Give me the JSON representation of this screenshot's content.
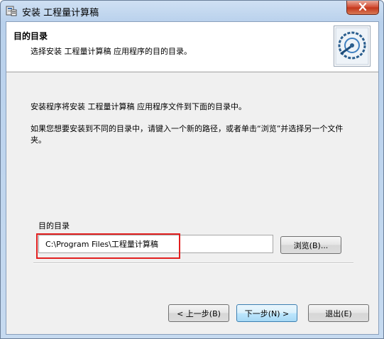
{
  "window": {
    "title": "安装 工程量计算稿"
  },
  "banner": {
    "title": "目的目录",
    "subtitle": "选择安装 工程量计算稿 应用程序的目的目录。"
  },
  "body": {
    "line1": "安装程序将安装 工程量计算稿 应用程序文件到下面的目录中。",
    "line2": "如果您想要安装到不同的目录中，请键入一个新的路径，或者单击“浏览”并选择另一个文件夹。"
  },
  "destination": {
    "label": "目的目录",
    "path": "C:\\Program Files\\工程量计算稿",
    "browse_label": "浏览(B)..."
  },
  "footer": {
    "back_label": "< 上一步(B)",
    "next_label": "下一步(N) >",
    "exit_label": "退出(E)"
  },
  "colors": {
    "highlight": "#e21f1f",
    "close_button": "#c2351b"
  },
  "icons": {
    "app": "installer-app-icon",
    "close": "close-icon",
    "banner": "disc-install-icon"
  }
}
